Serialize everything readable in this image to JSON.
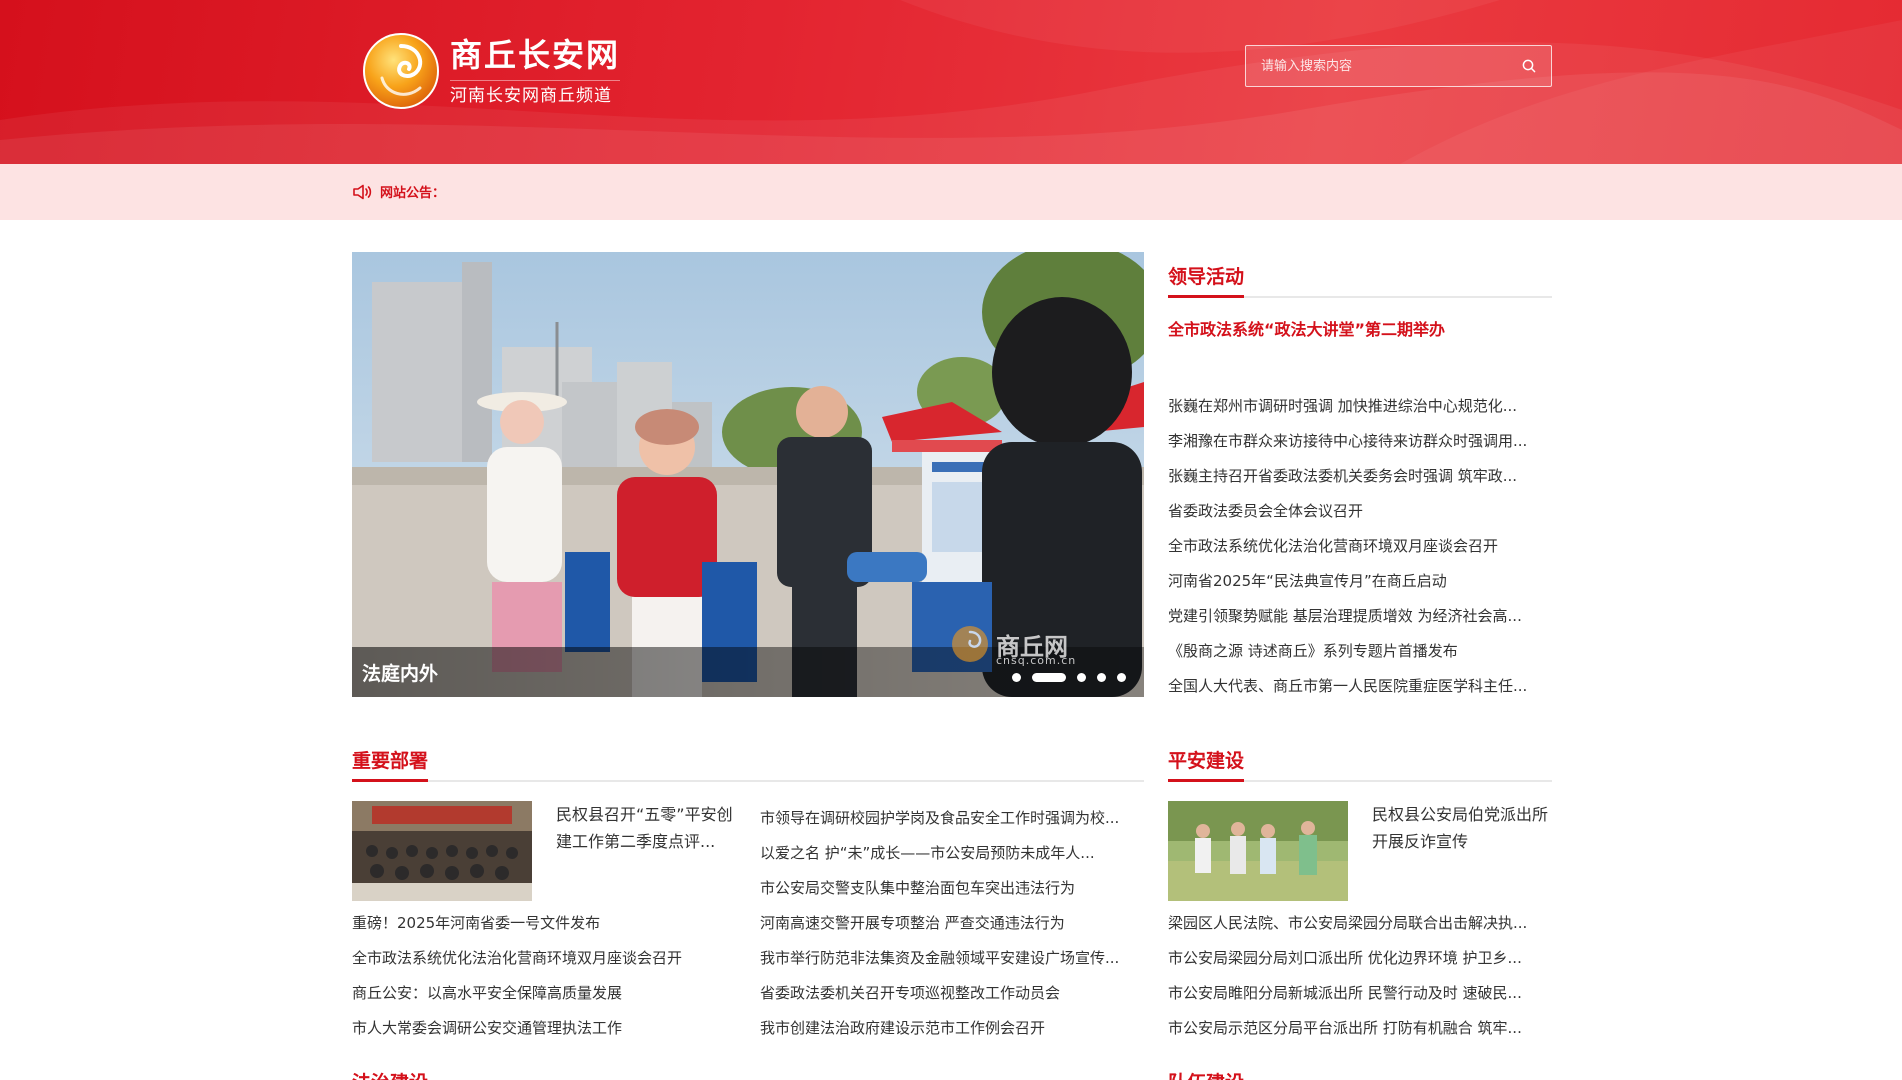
{
  "header": {
    "site_title": "商丘长安网",
    "site_subtitle": "河南长安网商丘频道",
    "search_placeholder": "请输入搜索内容"
  },
  "notice": {
    "label": "网站公告："
  },
  "carousel": {
    "caption": "法庭内外",
    "watermark": "商丘网",
    "watermark_url": "cnsq.com.cn",
    "slide_count": 5,
    "active_slide": 2
  },
  "leadership": {
    "title": "领导活动",
    "headline": "全市政法系统“政法大讲堂”第二期举办",
    "items": [
      "张巍在郑州市调研时强调 加快推进综治中心规范化...",
      "李湘豫在市群众来访接待中心接待来访群众时强调用...",
      "张巍主持召开省委政法委机关委务会时强调 筑牢政...",
      "省委政法委员会全体会议召开",
      "全市政法系统优化法治化营商环境双月座谈会召开",
      "河南省2025年“民法典宣传月”在商丘启动",
      "党建引领聚势赋能 基层治理提质增效 为经济社会高...",
      "《殷商之源 诗述商丘》系列专题片首播发布",
      "全国人大代表、商丘市第一人民医院重症医学科主任..."
    ]
  },
  "important": {
    "title": "重要部署",
    "feature_title": "民权县召开“五零”平安创建工作第二季度点评...",
    "left_items": [
      "重磅！2025年河南省委一号文件发布",
      "全市政法系统优化法治化营商环境双月座谈会召开",
      "商丘公安：以高水平安全保障高质量发展",
      "市人大常委会调研公安交通管理执法工作"
    ],
    "right_items": [
      "市领导在调研校园护学岗及食品安全工作时强调为校...",
      "以爱之名 护“未”成长——市公安局预防未成年人...",
      "市公安局交警支队集中整治面包车突出违法行为",
      "河南高速交警开展专项整治 严查交通违法行为",
      "我市举行防范非法集资及金融领域平安建设广场宣传...",
      "省委政法委机关召开专项巡视整改工作动员会",
      "我市创建法治政府建设示范市工作例会召开"
    ]
  },
  "safety": {
    "title": "平安建设",
    "feature_title": "民权县公安局伯党派出所开展反诈宣传",
    "items": [
      "梁园区人民法院、市公安局梁园分局联合出击解决执...",
      "市公安局梁园分局刘口派出所 优化边界环境 护卫乡...",
      "市公安局睢阳分局新城派出所 民警行动及时 速破民...",
      "市公安局示范区分局平台派出所 打防有机融合 筑牢..."
    ]
  },
  "bottom": {
    "left_title": "法治建设",
    "right_title": "队伍建设"
  },
  "colors": {
    "brand_red": "#d4111b",
    "notice_bg": "#fde3e3"
  }
}
